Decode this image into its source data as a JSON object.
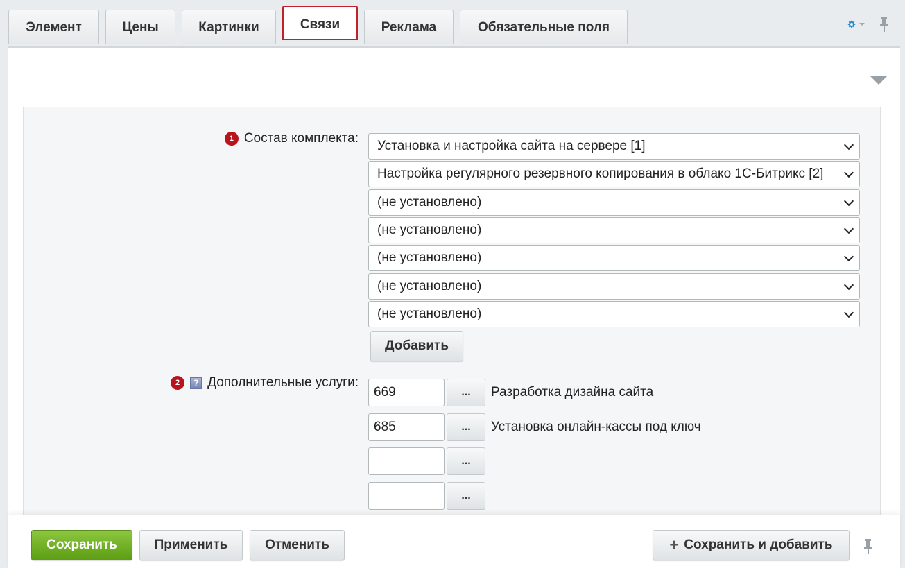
{
  "tabs": [
    {
      "label": "Элемент"
    },
    {
      "label": "Цены"
    },
    {
      "label": "Картинки"
    },
    {
      "label": "Связи"
    },
    {
      "label": "Реклама"
    },
    {
      "label": "Обязательные поля"
    }
  ],
  "accent_colors": {
    "active_tab_border": "#c0202a",
    "badge": "#b9141e",
    "save_green": "#6aae22",
    "gear_blue": "#1f8bd6"
  },
  "kit": {
    "badge": "1",
    "label": "Состав комплекта:",
    "selects": [
      "Установка и настройка сайта на сервере [1]",
      "Настройка регулярного резервного копирования в облако 1С-Битрикс [2]",
      "(не установлено)",
      "(не установлено)",
      "(не установлено)",
      "(не установлено)",
      "(не установлено)"
    ],
    "add_label": "Добавить"
  },
  "services": {
    "badge": "2",
    "help_glyph": "?",
    "label": "Дополнительные услуги:",
    "dots_label": "...",
    "rows": [
      {
        "id": "669",
        "name": "Разработка дизайна сайта"
      },
      {
        "id": "685",
        "name": "Установка онлайн-кассы под ключ"
      },
      {
        "id": "",
        "name": ""
      },
      {
        "id": "",
        "name": ""
      }
    ]
  },
  "footer": {
    "save": "Сохранить",
    "apply": "Применить",
    "cancel": "Отменить",
    "save_add": "Сохранить и добавить",
    "plus": "+"
  },
  "icons": [
    "gear-icon",
    "pin-icon",
    "collapse-arrow-icon",
    "chevron-down-icon",
    "help-icon",
    "plus-icon"
  ]
}
